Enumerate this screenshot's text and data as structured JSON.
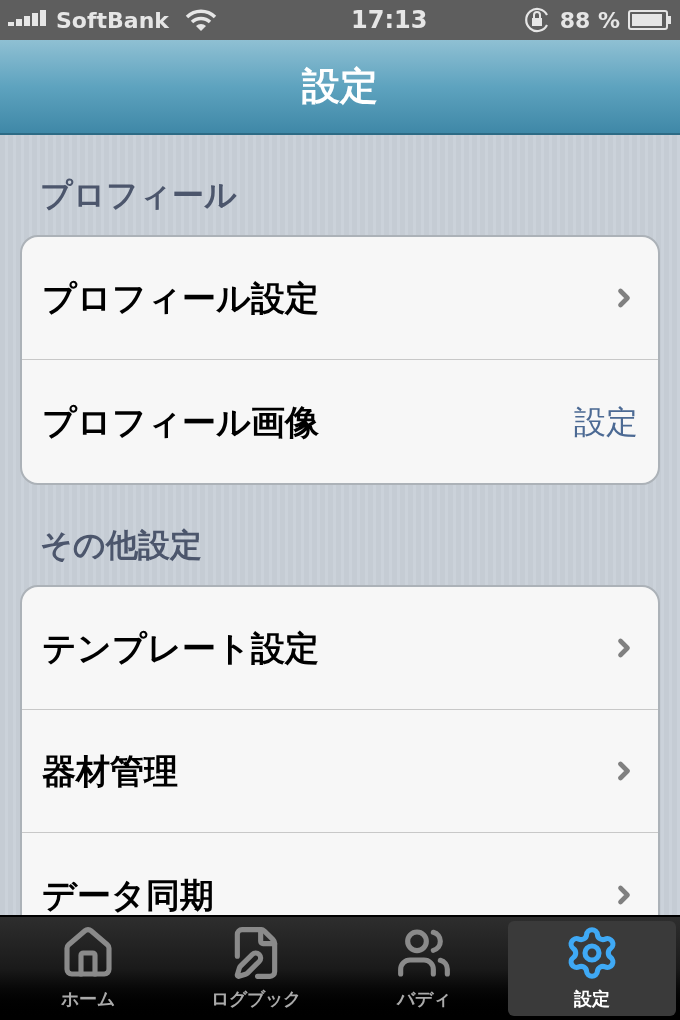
{
  "status_bar": {
    "carrier": "SoftBank",
    "time": "17:13",
    "battery": "88 %"
  },
  "nav_bar": {
    "title": "設定"
  },
  "sections": [
    {
      "header": "プロフィール",
      "rows": [
        {
          "label": "プロフィール設定",
          "kind": "chevron"
        },
        {
          "label": "プロフィール画像",
          "kind": "detail",
          "detail": "設定"
        }
      ]
    },
    {
      "header": "その他設定",
      "rows": [
        {
          "label": "テンプレート設定",
          "kind": "chevron"
        },
        {
          "label": "器材管理",
          "kind": "chevron"
        },
        {
          "label": "データ同期",
          "kind": "chevron"
        }
      ]
    }
  ],
  "tab_bar": [
    {
      "label": "ホーム",
      "kind": "home",
      "selected": false
    },
    {
      "label": "ログブック",
      "kind": "logbook",
      "selected": false
    },
    {
      "label": "バディ",
      "kind": "buddy",
      "selected": false
    },
    {
      "label": "設定",
      "kind": "settings",
      "selected": true
    }
  ]
}
